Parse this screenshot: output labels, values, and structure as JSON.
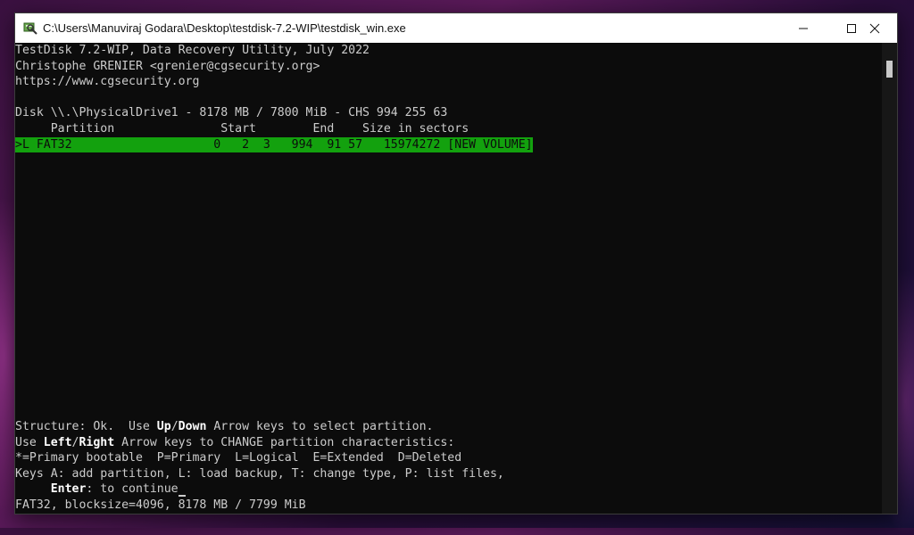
{
  "window": {
    "title": "C:\\Users\\Manuviraj Godara\\Desktop\\testdisk-7.2-WIP\\testdisk_win.exe",
    "minimize_icon": "minimize-icon",
    "maximize_icon": "maximize-icon",
    "close_icon": "close-icon"
  },
  "colors": {
    "console_bg": "#0c0c0c",
    "console_fg": "#cccccc",
    "highlight_bg": "#13a10e"
  },
  "console": {
    "header_line1": "TestDisk 7.2-WIP, Data Recovery Utility, July 2022",
    "header_line2": "Christophe GRENIER <grenier@cgsecurity.org>",
    "header_line3": "https://www.cgsecurity.org",
    "disk_line": "Disk \\\\.\\PhysicalDrive1 - 8178 MB / 7800 MiB - CHS 994 255 63",
    "columns_line": "     Partition               Start        End    Size in sectors",
    "partition_row": ">L FAT32                    0   2  3   994  91 57   15974272 [NEW VOLUME]",
    "status_line1": {
      "a": "Structure: Ok.  Use ",
      "b": "Up",
      "c": "/",
      "d": "Down",
      "e": " Arrow keys to select partition."
    },
    "status_line2": {
      "a": "Use ",
      "b": "Left",
      "c": "/",
      "d": "Right",
      "e": " Arrow keys to CHANGE partition characteristics:"
    },
    "legend_line": "*=Primary bootable  P=Primary  L=Logical  E=Extended  D=Deleted",
    "keys_line": "Keys A: add partition, L: load backup, T: change type, P: list files,",
    "enter_line": {
      "indent": "     ",
      "key": "Enter",
      "rest": ": to continue"
    },
    "footer_line": "FAT32, blocksize=4096, 8178 MB / 7799 MiB"
  }
}
